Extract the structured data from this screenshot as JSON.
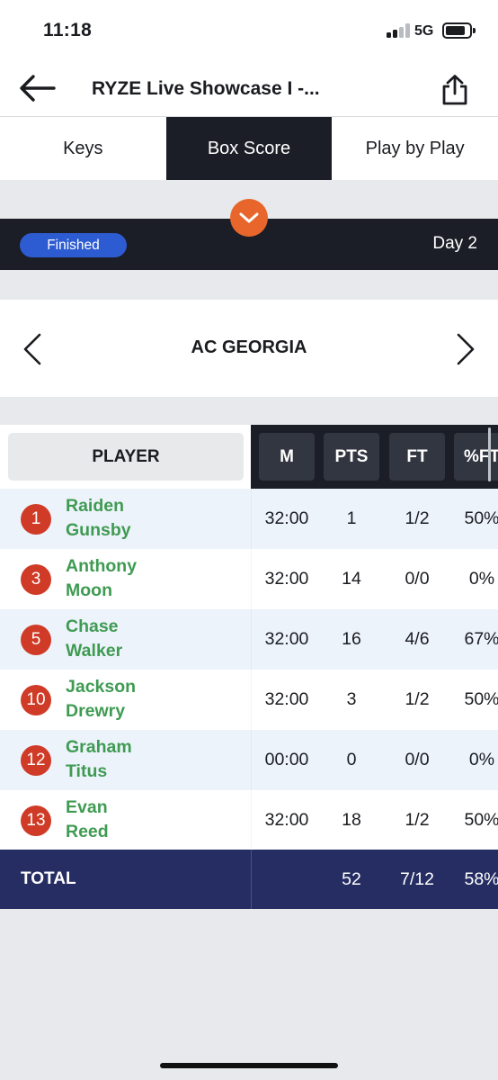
{
  "status_bar": {
    "time": "11:18",
    "network": "5G"
  },
  "nav": {
    "title": "RYZE Live Showcase I -..."
  },
  "tabs": [
    {
      "label": "Keys",
      "active": false
    },
    {
      "label": "Box Score",
      "active": true
    },
    {
      "label": "Play by Play",
      "active": false
    }
  ],
  "game": {
    "status": "Finished",
    "day": "Day 2"
  },
  "team": {
    "name": "AC GEORGIA"
  },
  "table": {
    "headers": {
      "player": "PLAYER",
      "m": "M",
      "pts": "PTS",
      "ft": "FT",
      "ft_pct": "%FT"
    },
    "rows": [
      {
        "number": "1",
        "first": "Raiden",
        "last": "Gunsby",
        "m": "32:00",
        "pts": "1",
        "ft": "1/2",
        "ft_pct": "50%"
      },
      {
        "number": "3",
        "first": "Anthony",
        "last": "Moon",
        "m": "32:00",
        "pts": "14",
        "ft": "0/0",
        "ft_pct": "0%"
      },
      {
        "number": "5",
        "first": "Chase",
        "last": "Walker",
        "m": "32:00",
        "pts": "16",
        "ft": "4/6",
        "ft_pct": "67%"
      },
      {
        "number": "10",
        "first": "Jackson",
        "last": "Drewry",
        "m": "32:00",
        "pts": "3",
        "ft": "1/2",
        "ft_pct": "50%"
      },
      {
        "number": "12",
        "first": "Graham",
        "last": "Titus",
        "m": "00:00",
        "pts": "0",
        "ft": "0/0",
        "ft_pct": "0%"
      },
      {
        "number": "13",
        "first": "Evan",
        "last": "Reed",
        "m": "32:00",
        "pts": "18",
        "ft": "1/2",
        "ft_pct": "50%"
      }
    ],
    "total": {
      "label": "TOTAL",
      "pts": "52",
      "ft": "7/12",
      "ft_pct": "58%"
    }
  },
  "colors": {
    "dark": "#1b1e27",
    "accent_orange": "#e8662b",
    "status_blue": "#2d5bd1",
    "player_green": "#3f9b52",
    "jersey_red": "#cf3b26",
    "total_navy": "#252d63"
  },
  "icons": {
    "back": "arrow-left-icon",
    "share": "share-icon",
    "expand": "chevron-down-icon",
    "prev_team": "chevron-left-icon",
    "next_team": "chevron-right-icon"
  }
}
